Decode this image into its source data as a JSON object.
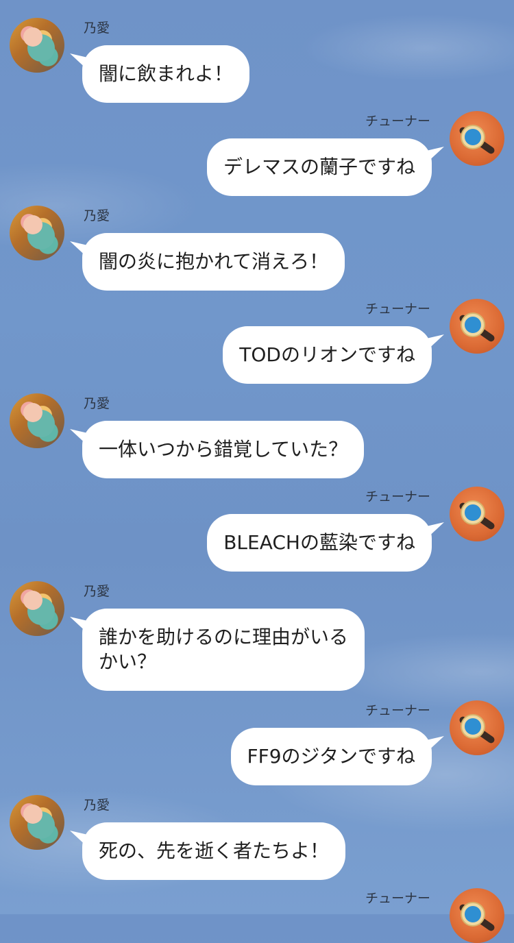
{
  "chat": {
    "messages": [
      {
        "sender": "乃愛",
        "side": "left",
        "text": "闇に飲まれよ！"
      },
      {
        "sender": "チューナー",
        "side": "right",
        "text": "デレマスの蘭子ですね"
      },
      {
        "sender": "乃愛",
        "side": "left",
        "text": "闇の炎に抱かれて消えろ！"
      },
      {
        "sender": "チューナー",
        "side": "right",
        "text": "TODのリオンですね"
      },
      {
        "sender": "乃愛",
        "side": "left",
        "text": "一体いつから錯覚していた？"
      },
      {
        "sender": "チューナー",
        "side": "right",
        "text": "BLEACHの藍染ですね"
      },
      {
        "sender": "乃愛",
        "side": "left",
        "text": "誰かを助けるのに理由がいる\nかい？"
      },
      {
        "sender": "チューナー",
        "side": "right",
        "text": "FF9のジタンですね"
      },
      {
        "sender": "乃愛",
        "side": "left",
        "text": "死の、先を逝く者たちよ！"
      },
      {
        "sender": "チューナー",
        "side": "right",
        "text": ""
      }
    ]
  },
  "theme": {
    "background": "#7197cb",
    "bubble": "#ffffff",
    "text": "#1f1f1f",
    "name_text": "#2b3442"
  }
}
